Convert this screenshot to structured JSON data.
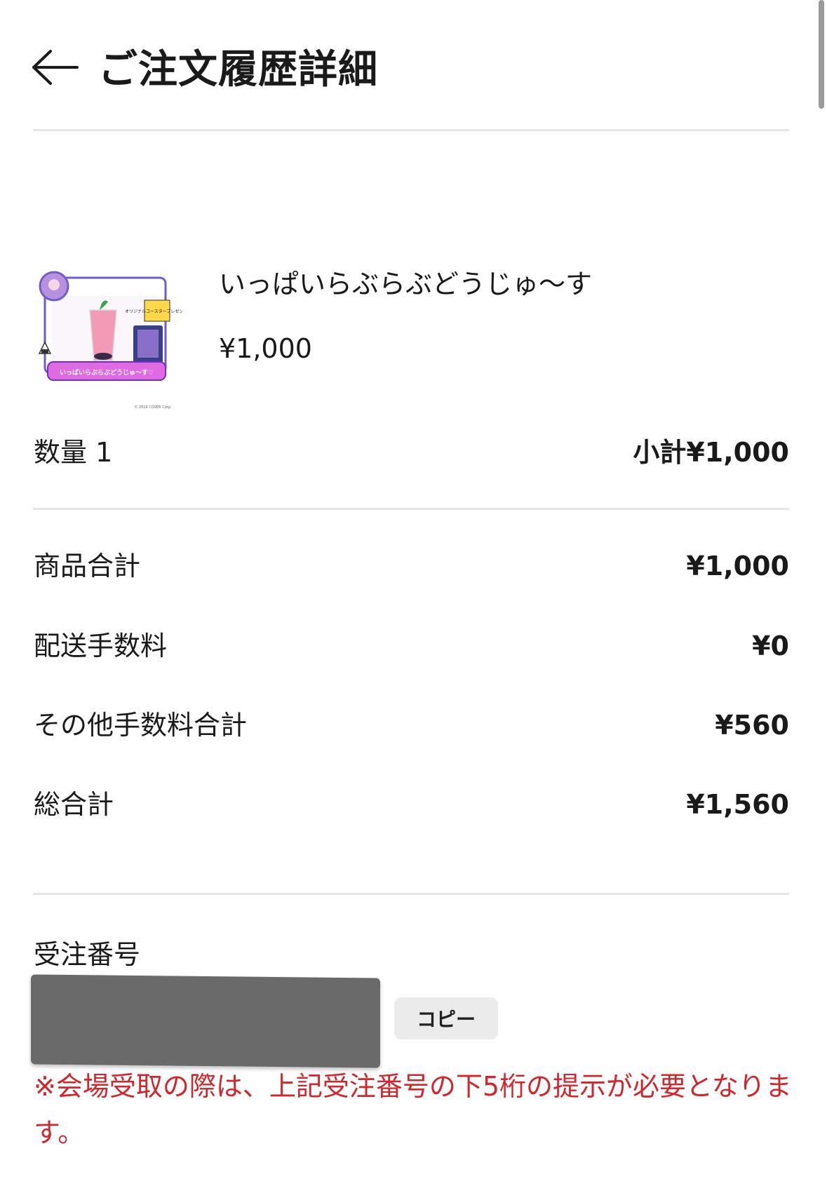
{
  "header": {
    "title": "ご注文履歴詳細"
  },
  "product": {
    "name": "いっぱいらぶらぶどうじゅ〜す",
    "price": "¥1,000",
    "image_text": "いっぱいらぶらぶどうじゅ〜す♡",
    "image_small_text": "オリジナルコースタープレゼント!",
    "image_copyright": "© 2016 COVER Corp."
  },
  "quantity": {
    "label": "数量 1",
    "subtotal": "小計¥1,000"
  },
  "summary": [
    {
      "label": "商品合計",
      "value": "¥1,000"
    },
    {
      "label": "配送手数料",
      "value": "¥0"
    },
    {
      "label": "その他手数料合計",
      "value": "¥560"
    },
    {
      "label": "総合計",
      "value": "¥1,560"
    }
  ],
  "order": {
    "label": "受注番号",
    "copy_label": "コピー",
    "notice": "※会場受取の際は、上記受注番号の下5桁の提示が必要となります。"
  },
  "colors": {
    "accent_red": "#d0262c",
    "divider": "#e6e6e6"
  }
}
